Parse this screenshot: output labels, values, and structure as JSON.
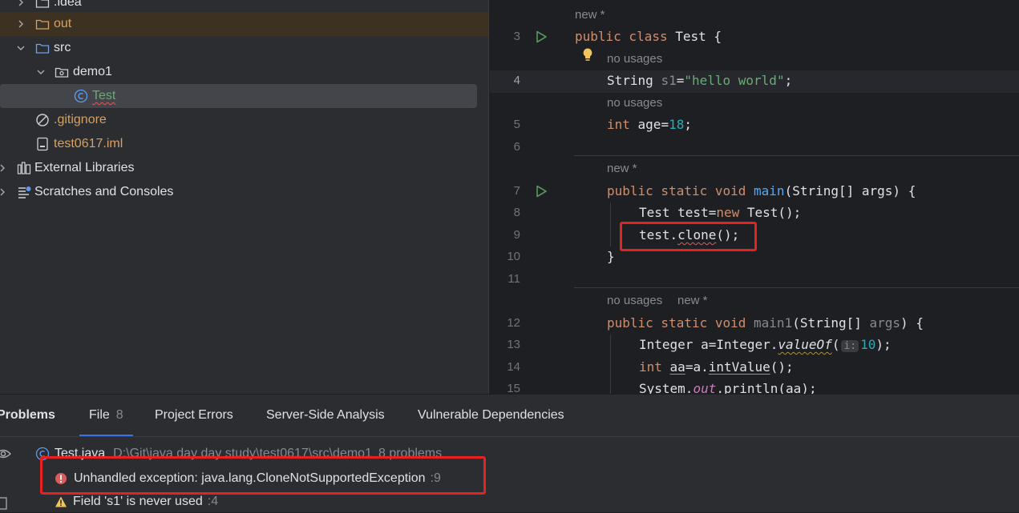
{
  "project_tree": {
    "items": [
      {
        "label": ".idea",
        "icon": "folder-icon"
      },
      {
        "label": "out",
        "icon": "folder-icon"
      },
      {
        "label": "src",
        "icon": "source-folder-icon"
      },
      {
        "label": "demo1",
        "icon": "package-icon"
      },
      {
        "label": "Test",
        "icon": "class-icon"
      },
      {
        "label": ".gitignore",
        "icon": "ignore-file-icon"
      },
      {
        "label": "test0617.iml",
        "icon": "module-file-icon"
      },
      {
        "label": "External Libraries",
        "icon": "library-icon"
      },
      {
        "label": "Scratches and Consoles",
        "icon": "scratches-icon"
      }
    ]
  },
  "editor": {
    "line_numbers": [
      "3",
      "4",
      "5",
      "6",
      "7",
      "8",
      "9",
      "10",
      "11",
      "12",
      "13",
      "14",
      "15"
    ],
    "hints": {
      "new_star": "new *",
      "no_usages": "no usages"
    },
    "code": {
      "l3_kw": "public class",
      "l3_rest": " Test {",
      "l4_type": "String ",
      "l4_var": "s1",
      "l4_eq": "=",
      "l4_str": "\"hello world\"",
      "l4_end": ";",
      "l5_kw": "int",
      "l5_rest": " age=",
      "l5_num": "18",
      "l5_end": ";",
      "l7_kw": "public static void",
      "l7_fn": " main",
      "l7_rest": "(String[] args) {",
      "l8_a": "Test test=",
      "l8_kw": "new",
      "l8_b": " Test();",
      "l9_a": "test.",
      "l9_fn": "clone",
      "l9_b": "();",
      "l10": "}",
      "l12_kw": "public static void",
      "l12_fn": " main1",
      "l12_a": "(String[] ",
      "l12_args": "args",
      "l12_b": ") {",
      "l13_a": "Integer a=Integer.",
      "l13_fn": "valueOf",
      "l13_b": "(",
      "l13_hint": "i:",
      "l13_num": "10",
      "l13_c": ");",
      "l14_kw": "int",
      "l14_sp": " ",
      "l14_var": "aa",
      "l14_a": "=a.",
      "l14_fn": "intValue",
      "l14_b": "();",
      "l15_a": "System.",
      "l15_out": "out",
      "l15_b": ".println(aa);"
    }
  },
  "problems": {
    "title": "Problems",
    "tabs": [
      {
        "label": "File",
        "count": "8"
      },
      {
        "label": "Project Errors"
      },
      {
        "label": "Server-Side Analysis"
      },
      {
        "label": "Vulnerable Dependencies"
      }
    ],
    "file_row": {
      "name": "Test.java",
      "path": "D:\\Git\\java day day study\\test0617\\src\\demo1",
      "count": "8 problems"
    },
    "items": [
      {
        "severity": "error",
        "message": "Unhandled exception: java.lang.CloneNotSupportedException",
        "line": ":9"
      },
      {
        "severity": "warning",
        "message": "Field 's1' is never used",
        "line": ":4"
      }
    ]
  },
  "colors": {
    "highlight_box": "#e5221f",
    "accent": "#3574f0",
    "keyword": "#cf8e6d",
    "string": "#6aab73",
    "number": "#2aacb8",
    "function": "#56a8f5"
  }
}
